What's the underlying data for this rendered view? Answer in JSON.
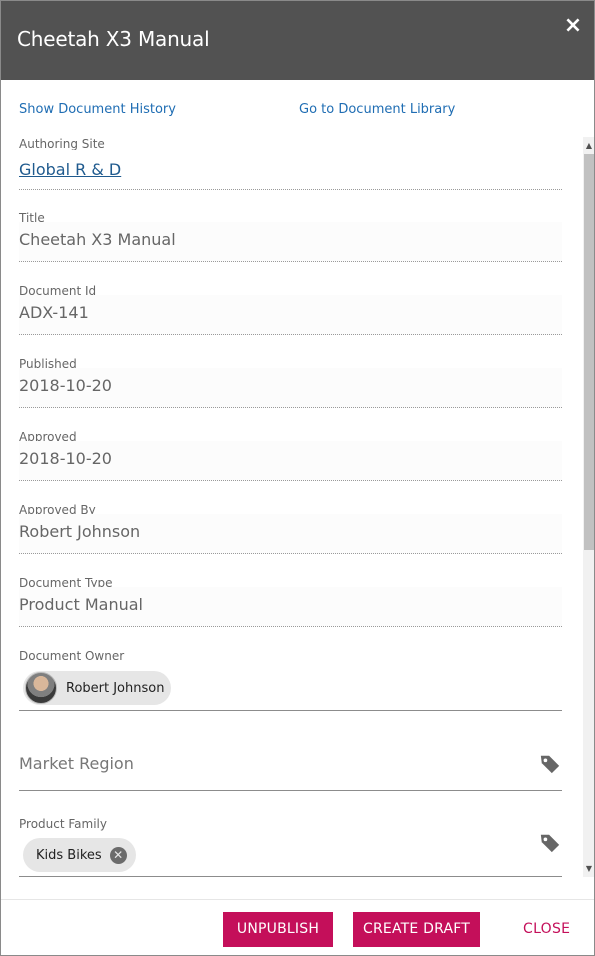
{
  "header": {
    "title": "Cheetah X3 Manual",
    "close_symbol": "×"
  },
  "links": {
    "history": "Show Document History",
    "library": "Go to Document Library"
  },
  "fields": {
    "authoring_site": {
      "label": "Authoring Site",
      "value": "Global R & D"
    },
    "title": {
      "label": "Title",
      "value": "Cheetah X3 Manual"
    },
    "document_id": {
      "label": "Document Id",
      "value": "ADX-141"
    },
    "published": {
      "label": "Published",
      "value": "2018-10-20"
    },
    "approved": {
      "label": "Approved",
      "value": "2018-10-20"
    },
    "approved_by": {
      "label": "Approved By",
      "value": "Robert Johnson"
    },
    "document_type": {
      "label": "Document Type",
      "value": "Product Manual"
    },
    "document_owner": {
      "label": "Document Owner",
      "chip": "Robert Johnson"
    },
    "market_region": {
      "placeholder": "Market Region"
    },
    "product_family": {
      "label": "Product Family",
      "chip": "Kids Bikes",
      "chip_remove": "✕"
    }
  },
  "scrollbar": {
    "up": "▲",
    "down": "▼"
  },
  "footer": {
    "unpublish": "UNPUBLISH",
    "create_draft": "CREATE DRAFT",
    "close": "CLOSE"
  },
  "icons": {
    "tag": "tag-icon",
    "close": "close-icon",
    "remove": "remove-chip-icon"
  },
  "colors": {
    "header_bg": "#525252",
    "accent": "#c40f5a",
    "link": "#1f6db3"
  }
}
